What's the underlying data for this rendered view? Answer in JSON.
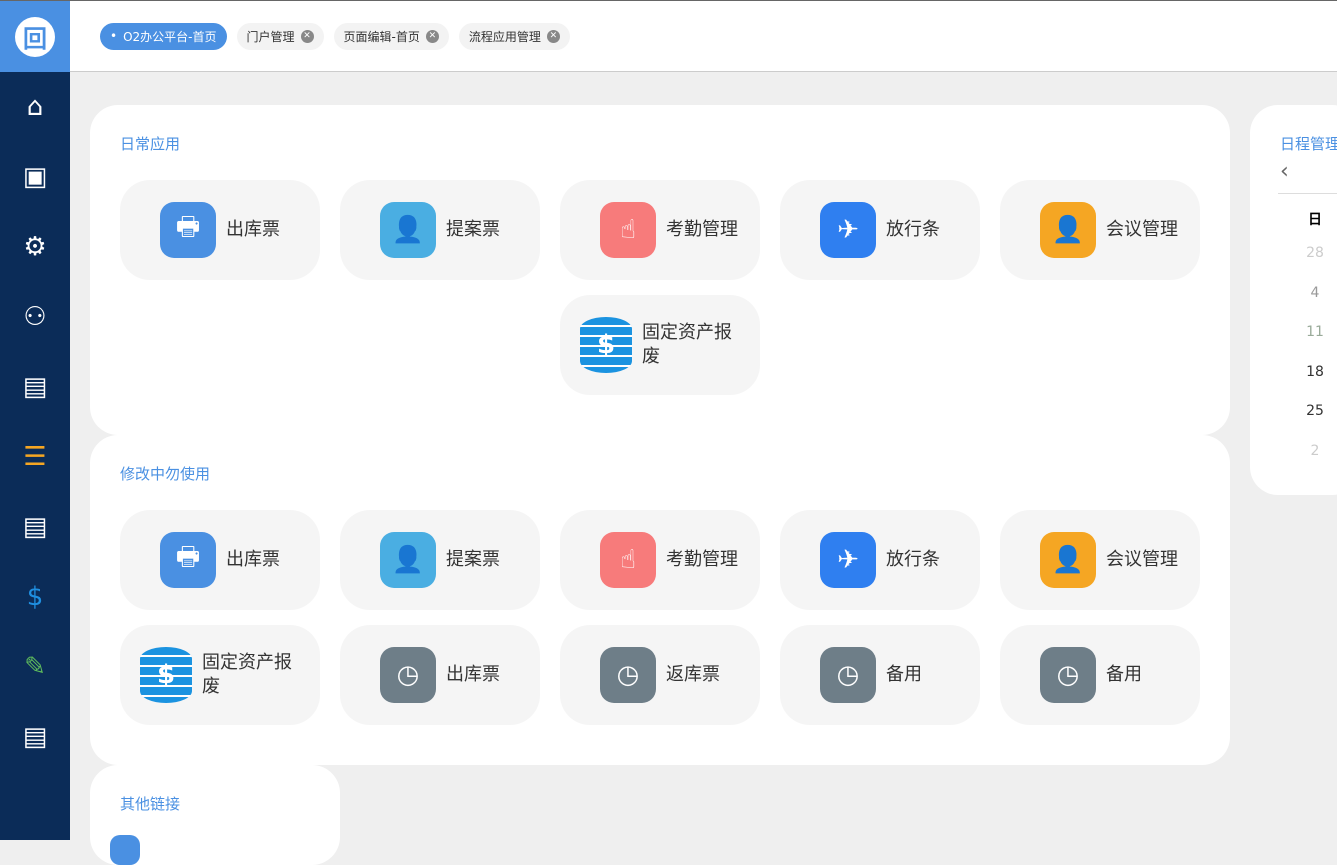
{
  "tabs": [
    {
      "label": "O2办公平台-首页",
      "active": true
    },
    {
      "label": "门户管理"
    },
    {
      "label": "页面编辑-首页"
    },
    {
      "label": "流程应用管理"
    }
  ],
  "sidebar": [
    "home-icon",
    "monitor-user-icon",
    "user-settings-icon",
    "org-chart-icon",
    "dashboard-icon",
    "server-settings-icon",
    "dashboard-icon",
    "coins-icon",
    "document-edit-icon",
    "dashboard-icon"
  ],
  "sections": [
    {
      "title": "日常应用",
      "tiles": [
        {
          "label": "出库票",
          "icon": "printer-icon",
          "color": "#4a90e2",
          "glyph": "🖶"
        },
        {
          "label": "提案票",
          "icon": "user-clock-icon",
          "color": "#4aaee2",
          "glyph": "👤"
        },
        {
          "label": "考勤管理",
          "icon": "touch-icon",
          "color": "#f77b7b",
          "glyph": "☝"
        },
        {
          "label": "放行条",
          "icon": "plane-icon",
          "color": "#2f7ff0",
          "glyph": "✈"
        },
        {
          "label": "会议管理",
          "icon": "presenter-icon",
          "color": "#f5a623",
          "glyph": "👤"
        },
        {
          "label": "固定资产报废",
          "icon": "coins-icon",
          "color": "coin",
          "glyph": "$"
        }
      ]
    },
    {
      "title": "修改中勿使用",
      "tiles": [
        {
          "label": "出库票",
          "icon": "printer-icon",
          "color": "#4a90e2",
          "glyph": "🖶"
        },
        {
          "label": "提案票",
          "icon": "user-clock-icon",
          "color": "#4aaee2",
          "glyph": "👤"
        },
        {
          "label": "考勤管理",
          "icon": "touch-icon",
          "color": "#f77b7b",
          "glyph": "☝"
        },
        {
          "label": "放行条",
          "icon": "plane-icon",
          "color": "#2f7ff0",
          "glyph": "✈"
        },
        {
          "label": "会议管理",
          "icon": "presenter-icon",
          "color": "#f5a623",
          "glyph": "👤"
        },
        {
          "label": "固定资产报废",
          "icon": "coins-icon",
          "color": "coin",
          "glyph": "$"
        },
        {
          "label": "出库票",
          "icon": "clock-add-icon",
          "color": "#6e7e88",
          "glyph": "◷"
        },
        {
          "label": "返库票",
          "icon": "clock-add-icon",
          "color": "#6e7e88",
          "glyph": "◷"
        },
        {
          "label": "备用",
          "icon": "clock-add-icon",
          "color": "#6e7e88",
          "glyph": "◷"
        },
        {
          "label": "备用",
          "icon": "clock-add-icon",
          "color": "#6e7e88",
          "glyph": "◷"
        }
      ]
    },
    {
      "title": "其他链接",
      "tiles": []
    }
  ],
  "calendar": {
    "title": "日程管理",
    "prev": "‹",
    "weekday": "日",
    "days": [
      {
        "d": "28",
        "c": "#ccc"
      },
      {
        "d": "4",
        "c": "#999"
      },
      {
        "d": "11",
        "c": "#9a9"
      },
      {
        "d": "18",
        "c": "#333"
      },
      {
        "d": "25",
        "c": "#333"
      },
      {
        "d": "2",
        "c": "#ccc"
      }
    ]
  }
}
